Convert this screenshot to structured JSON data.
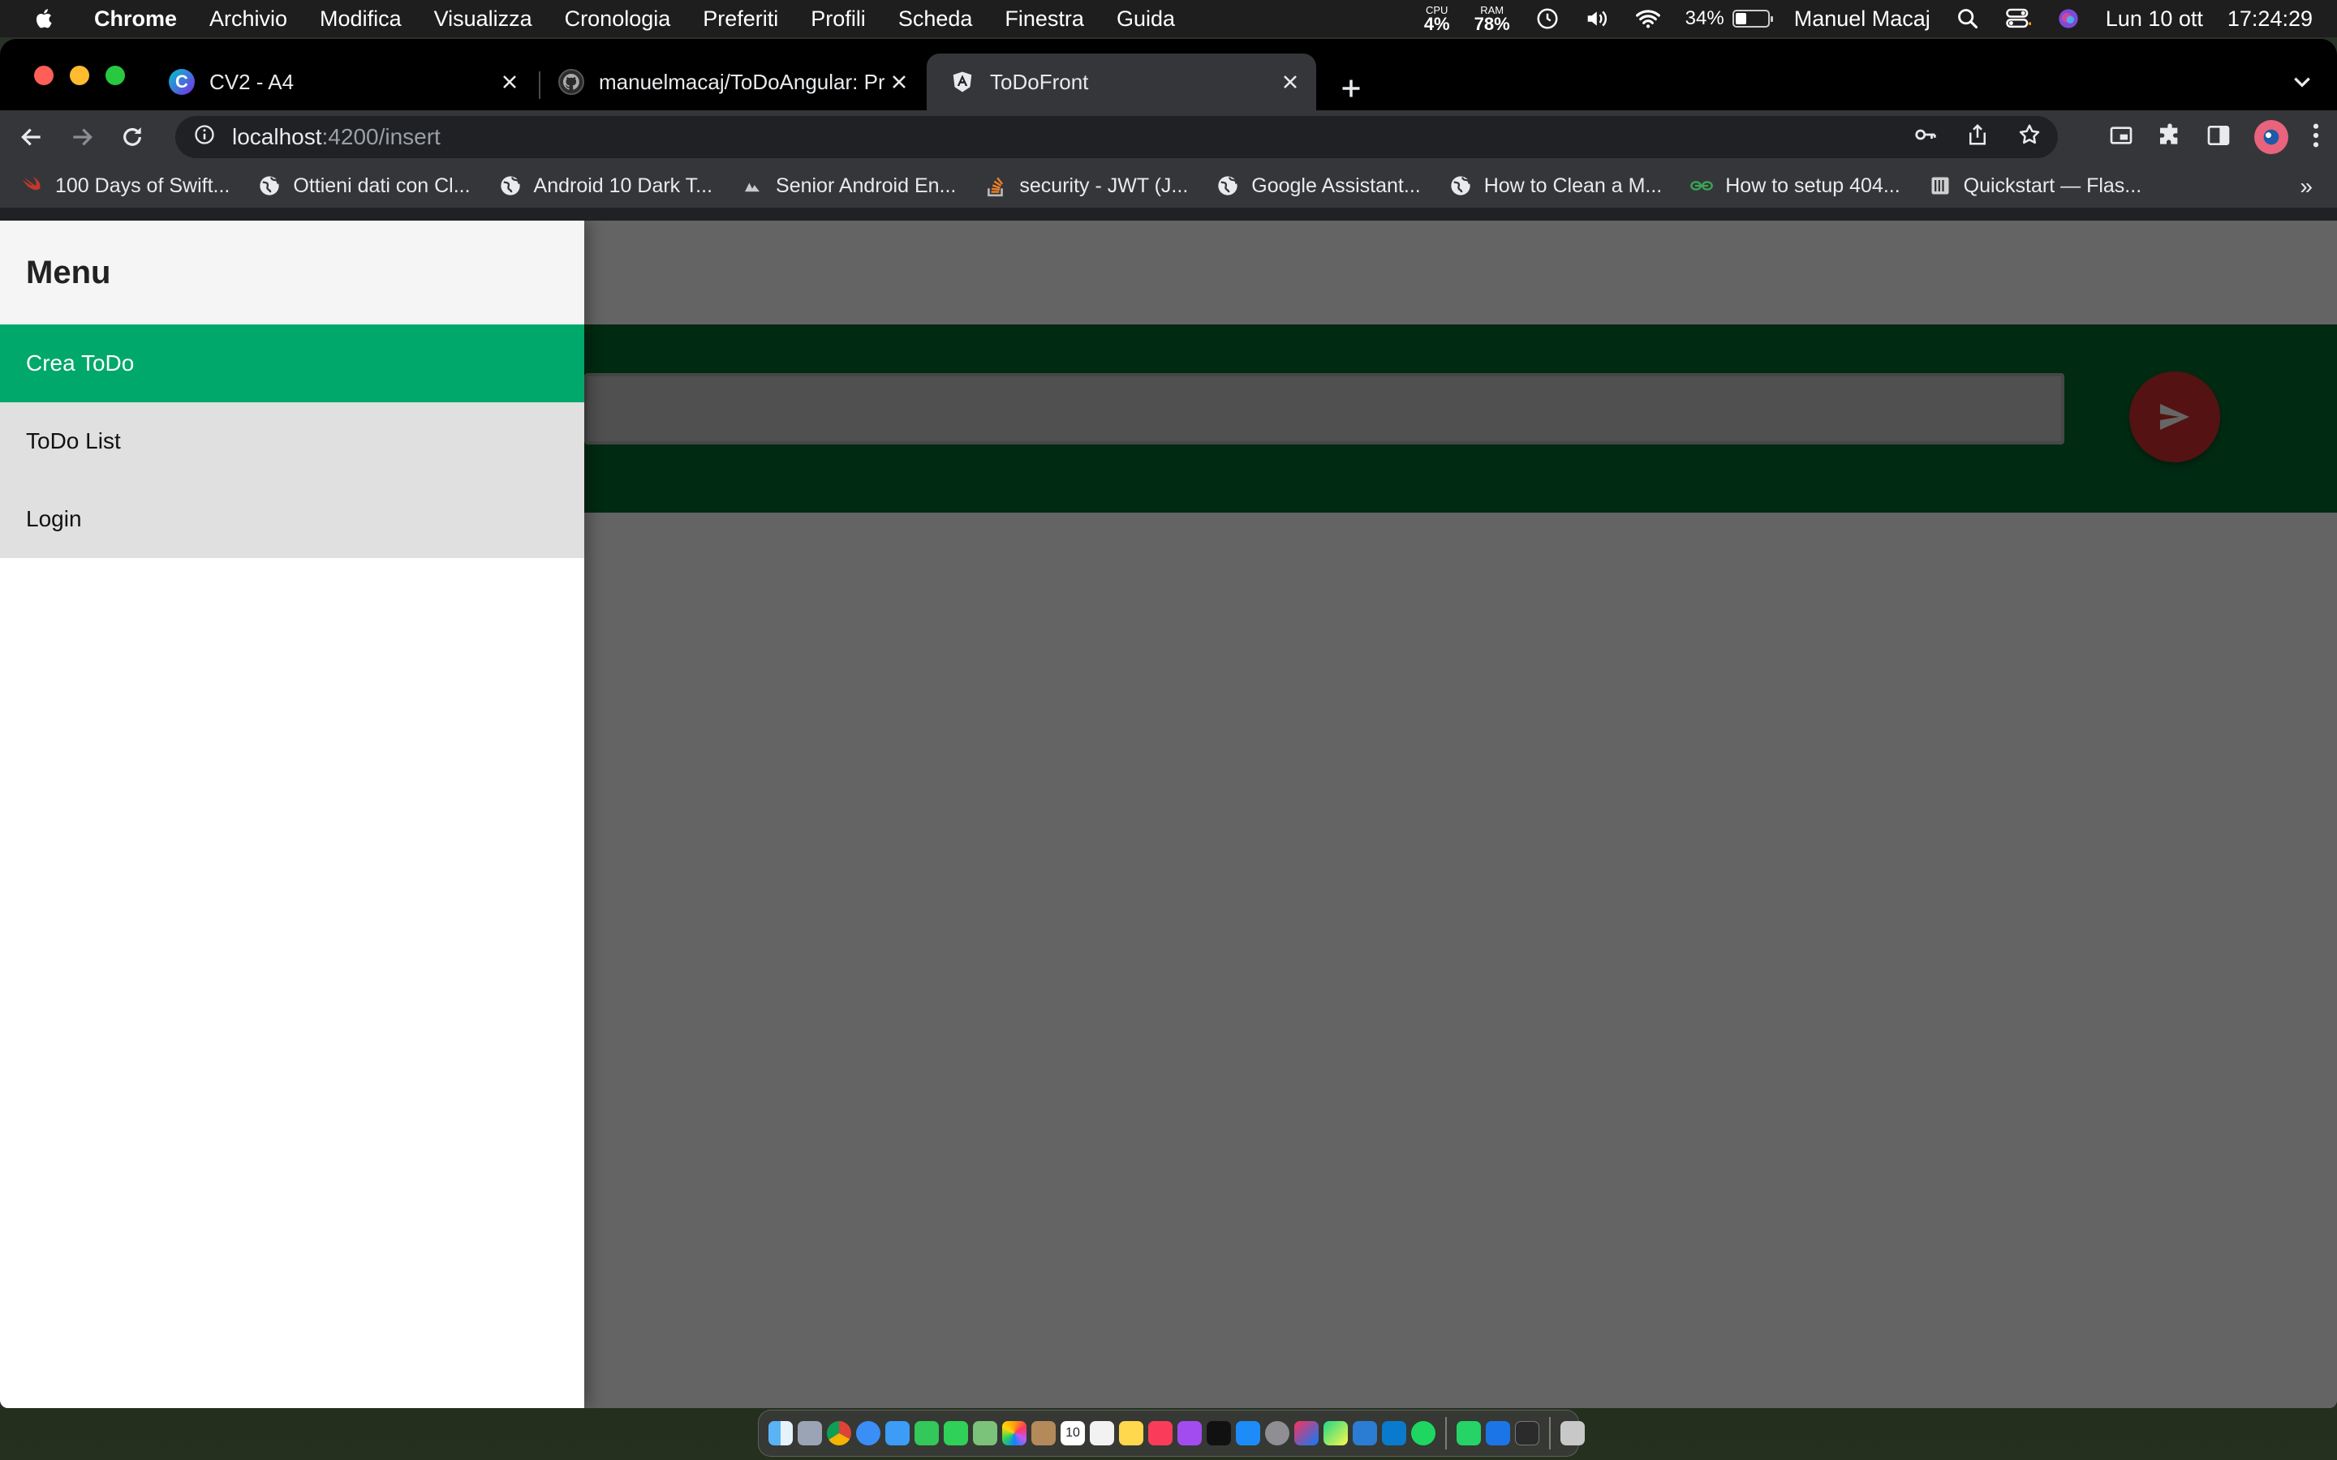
{
  "menubar": {
    "app_name": "Chrome",
    "menus": [
      "Archivio",
      "Modifica",
      "Visualizza",
      "Cronologia",
      "Preferiti",
      "Profili",
      "Scheda",
      "Finestra",
      "Guida"
    ],
    "cpu_label": "CPU",
    "cpu_value": "4%",
    "ram_label": "RAM",
    "ram_value": "78%",
    "battery_percent": "34%",
    "battery_level": 0.34,
    "user_name": "Manuel Macaj",
    "date": "Lun 10 ott",
    "time": "17:24:29"
  },
  "tabs": [
    {
      "title": "CV2 - A4",
      "icon": "canva-icon",
      "active": false
    },
    {
      "title": "manuelmacaj/ToDoAngular: Pri",
      "icon": "github-icon",
      "active": false
    },
    {
      "title": "ToDoFront",
      "icon": "angular-icon",
      "active": true
    }
  ],
  "address_bar": {
    "host": "localhost",
    "path": ":4200/insert"
  },
  "bookmarks": [
    {
      "label": "100 Days of Swift...",
      "icon": "swift-icon"
    },
    {
      "label": "Ottieni dati con Cl...",
      "icon": "globe-icon"
    },
    {
      "label": "Android 10 Dark T...",
      "icon": "globe-icon"
    },
    {
      "label": "Senior Android En...",
      "icon": "company-icon"
    },
    {
      "label": "security - JWT (J...",
      "icon": "stackoverflow-icon"
    },
    {
      "label": "Google Assistant...",
      "icon": "globe-icon"
    },
    {
      "label": "How to Clean a M...",
      "icon": "globe-icon"
    },
    {
      "label": "How to setup 404...",
      "icon": "link-icon"
    },
    {
      "label": "Quickstart — Flas...",
      "icon": "flask-icon"
    }
  ],
  "bookmarks_more": "»",
  "app": {
    "drawer_title": "Menu",
    "nav_items": [
      {
        "label": "Crea ToDo",
        "active": true
      },
      {
        "label": "ToDo List",
        "active": false
      },
      {
        "label": "Login",
        "active": false
      }
    ],
    "todo_input_value": ""
  },
  "colors": {
    "accent_green": "#00a86b",
    "band_green": "#00692f",
    "send_button": "#d32f2f"
  },
  "dock": {
    "apps": [
      "finder-icon",
      "launchpad-icon",
      "chrome-icon",
      "safari-icon",
      "mail-icon",
      "facetime-icon",
      "messages-icon",
      "maps-icon",
      "photos-icon",
      "contacts-icon",
      "calendar-icon",
      "reminders-icon",
      "notes-icon",
      "music-icon",
      "podcasts-icon",
      "tv-icon",
      "appstore-icon",
      "settings-icon",
      "intellij-icon",
      "pycharm-icon",
      "word-icon",
      "vscode-icon",
      "spotify-icon",
      "whatsapp-icon",
      "xcode-icon",
      "terminal-icon",
      "trash-icon"
    ],
    "calendar_day": "10"
  }
}
